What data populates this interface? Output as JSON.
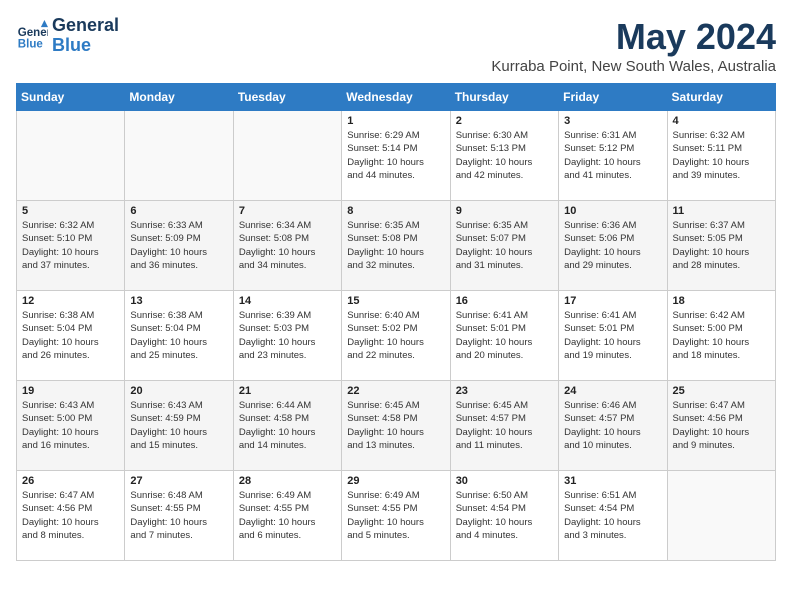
{
  "header": {
    "logo_line1": "General",
    "logo_line2": "Blue",
    "month": "May 2024",
    "location": "Kurraba Point, New South Wales, Australia"
  },
  "days_of_week": [
    "Sunday",
    "Monday",
    "Tuesday",
    "Wednesday",
    "Thursday",
    "Friday",
    "Saturday"
  ],
  "weeks": [
    [
      {
        "day": "",
        "info": ""
      },
      {
        "day": "",
        "info": ""
      },
      {
        "day": "",
        "info": ""
      },
      {
        "day": "1",
        "info": "Sunrise: 6:29 AM\nSunset: 5:14 PM\nDaylight: 10 hours\nand 44 minutes."
      },
      {
        "day": "2",
        "info": "Sunrise: 6:30 AM\nSunset: 5:13 PM\nDaylight: 10 hours\nand 42 minutes."
      },
      {
        "day": "3",
        "info": "Sunrise: 6:31 AM\nSunset: 5:12 PM\nDaylight: 10 hours\nand 41 minutes."
      },
      {
        "day": "4",
        "info": "Sunrise: 6:32 AM\nSunset: 5:11 PM\nDaylight: 10 hours\nand 39 minutes."
      }
    ],
    [
      {
        "day": "5",
        "info": "Sunrise: 6:32 AM\nSunset: 5:10 PM\nDaylight: 10 hours\nand 37 minutes."
      },
      {
        "day": "6",
        "info": "Sunrise: 6:33 AM\nSunset: 5:09 PM\nDaylight: 10 hours\nand 36 minutes."
      },
      {
        "day": "7",
        "info": "Sunrise: 6:34 AM\nSunset: 5:08 PM\nDaylight: 10 hours\nand 34 minutes."
      },
      {
        "day": "8",
        "info": "Sunrise: 6:35 AM\nSunset: 5:08 PM\nDaylight: 10 hours\nand 32 minutes."
      },
      {
        "day": "9",
        "info": "Sunrise: 6:35 AM\nSunset: 5:07 PM\nDaylight: 10 hours\nand 31 minutes."
      },
      {
        "day": "10",
        "info": "Sunrise: 6:36 AM\nSunset: 5:06 PM\nDaylight: 10 hours\nand 29 minutes."
      },
      {
        "day": "11",
        "info": "Sunrise: 6:37 AM\nSunset: 5:05 PM\nDaylight: 10 hours\nand 28 minutes."
      }
    ],
    [
      {
        "day": "12",
        "info": "Sunrise: 6:38 AM\nSunset: 5:04 PM\nDaylight: 10 hours\nand 26 minutes."
      },
      {
        "day": "13",
        "info": "Sunrise: 6:38 AM\nSunset: 5:04 PM\nDaylight: 10 hours\nand 25 minutes."
      },
      {
        "day": "14",
        "info": "Sunrise: 6:39 AM\nSunset: 5:03 PM\nDaylight: 10 hours\nand 23 minutes."
      },
      {
        "day": "15",
        "info": "Sunrise: 6:40 AM\nSunset: 5:02 PM\nDaylight: 10 hours\nand 22 minutes."
      },
      {
        "day": "16",
        "info": "Sunrise: 6:41 AM\nSunset: 5:01 PM\nDaylight: 10 hours\nand 20 minutes."
      },
      {
        "day": "17",
        "info": "Sunrise: 6:41 AM\nSunset: 5:01 PM\nDaylight: 10 hours\nand 19 minutes."
      },
      {
        "day": "18",
        "info": "Sunrise: 6:42 AM\nSunset: 5:00 PM\nDaylight: 10 hours\nand 18 minutes."
      }
    ],
    [
      {
        "day": "19",
        "info": "Sunrise: 6:43 AM\nSunset: 5:00 PM\nDaylight: 10 hours\nand 16 minutes."
      },
      {
        "day": "20",
        "info": "Sunrise: 6:43 AM\nSunset: 4:59 PM\nDaylight: 10 hours\nand 15 minutes."
      },
      {
        "day": "21",
        "info": "Sunrise: 6:44 AM\nSunset: 4:58 PM\nDaylight: 10 hours\nand 14 minutes."
      },
      {
        "day": "22",
        "info": "Sunrise: 6:45 AM\nSunset: 4:58 PM\nDaylight: 10 hours\nand 13 minutes."
      },
      {
        "day": "23",
        "info": "Sunrise: 6:45 AM\nSunset: 4:57 PM\nDaylight: 10 hours\nand 11 minutes."
      },
      {
        "day": "24",
        "info": "Sunrise: 6:46 AM\nSunset: 4:57 PM\nDaylight: 10 hours\nand 10 minutes."
      },
      {
        "day": "25",
        "info": "Sunrise: 6:47 AM\nSunset: 4:56 PM\nDaylight: 10 hours\nand 9 minutes."
      }
    ],
    [
      {
        "day": "26",
        "info": "Sunrise: 6:47 AM\nSunset: 4:56 PM\nDaylight: 10 hours\nand 8 minutes."
      },
      {
        "day": "27",
        "info": "Sunrise: 6:48 AM\nSunset: 4:55 PM\nDaylight: 10 hours\nand 7 minutes."
      },
      {
        "day": "28",
        "info": "Sunrise: 6:49 AM\nSunset: 4:55 PM\nDaylight: 10 hours\nand 6 minutes."
      },
      {
        "day": "29",
        "info": "Sunrise: 6:49 AM\nSunset: 4:55 PM\nDaylight: 10 hours\nand 5 minutes."
      },
      {
        "day": "30",
        "info": "Sunrise: 6:50 AM\nSunset: 4:54 PM\nDaylight: 10 hours\nand 4 minutes."
      },
      {
        "day": "31",
        "info": "Sunrise: 6:51 AM\nSunset: 4:54 PM\nDaylight: 10 hours\nand 3 minutes."
      },
      {
        "day": "",
        "info": ""
      }
    ]
  ]
}
